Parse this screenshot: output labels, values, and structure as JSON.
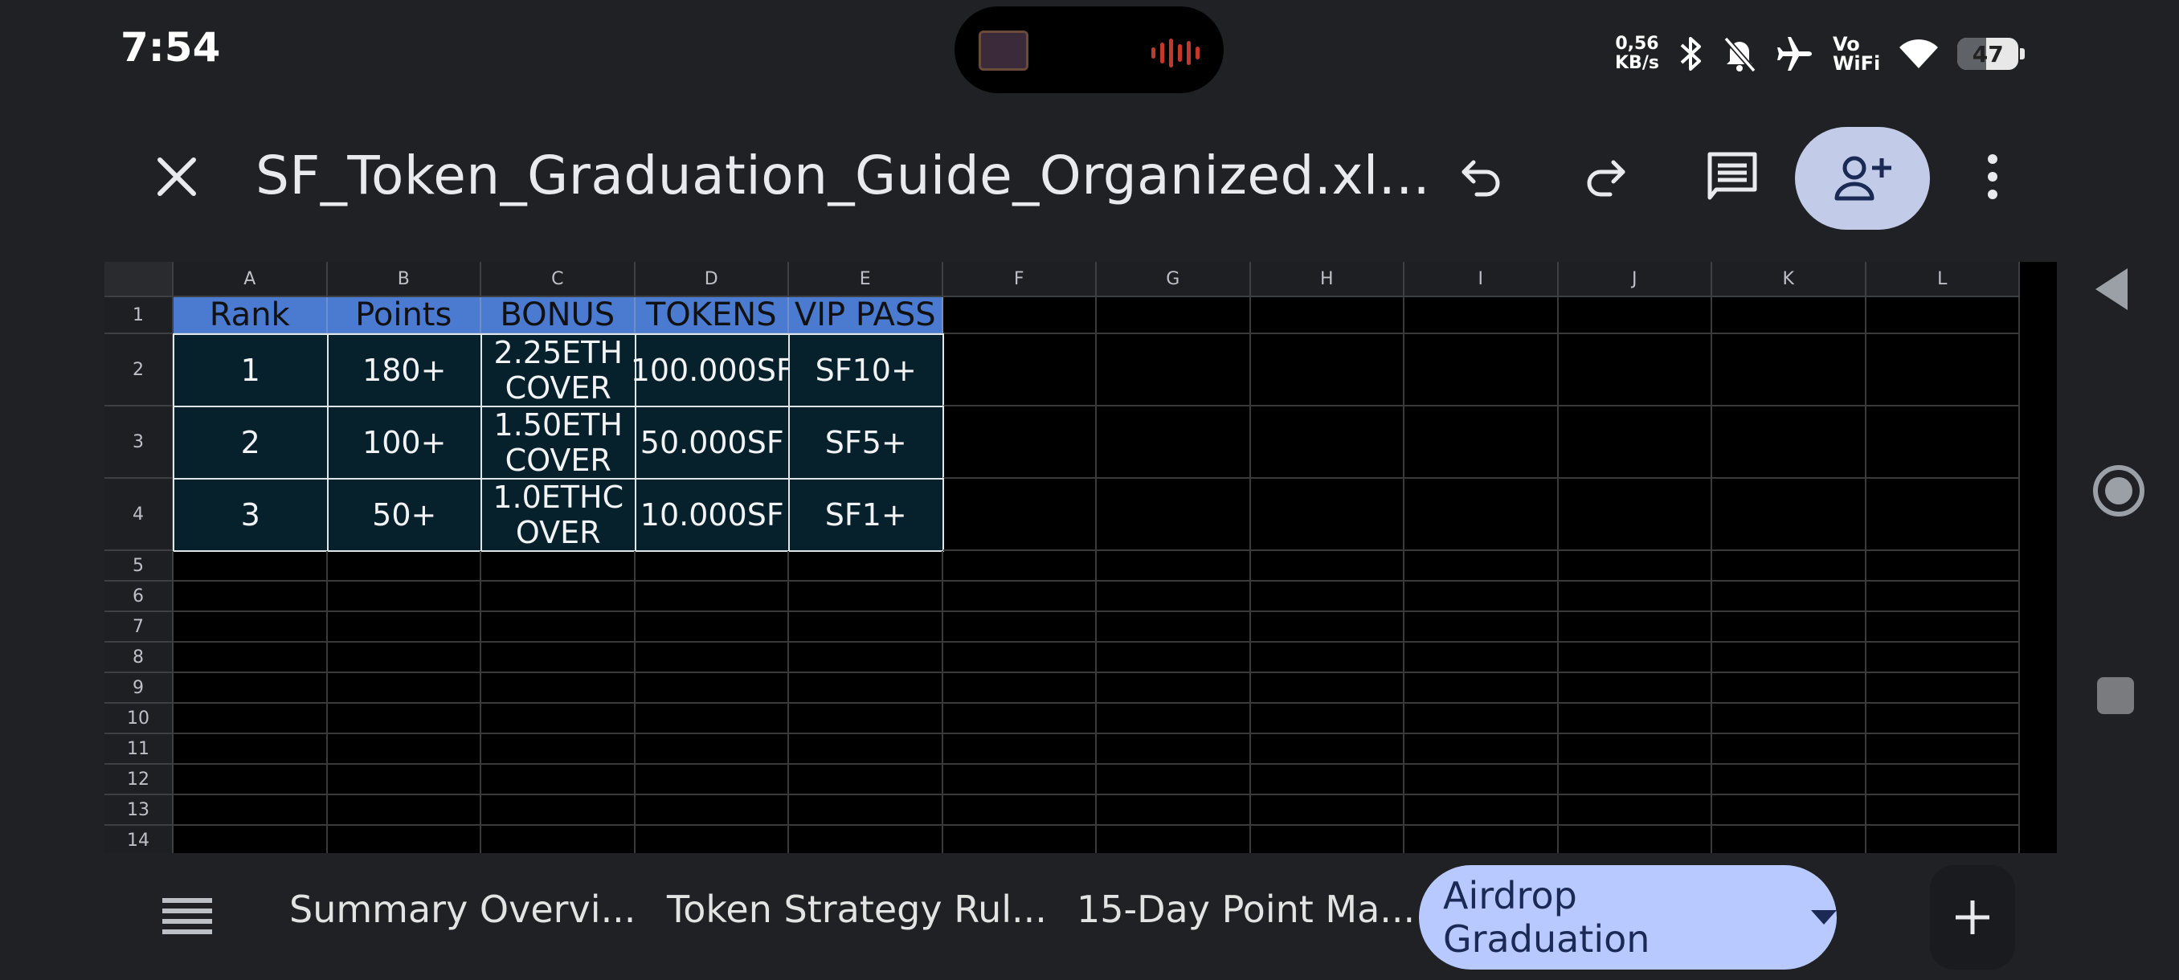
{
  "status_bar": {
    "time": "7:54",
    "net_speed_value": "0,56",
    "net_speed_unit": "KB/s",
    "vowifi_top": "Vo",
    "vowifi_bottom": "WiFi",
    "battery": "47",
    "battery_level_percent": 47
  },
  "toolbar": {
    "title": "SF_Token_Graduation_Guide_Organized.xl..."
  },
  "grid": {
    "columns": [
      "A",
      "B",
      "C",
      "D",
      "E",
      "F",
      "G",
      "H",
      "I",
      "J",
      "K",
      "L"
    ],
    "rows": [
      "1",
      "2",
      "3",
      "4",
      "5",
      "6",
      "7",
      "8",
      "9",
      "10",
      "11",
      "12",
      "13",
      "14"
    ],
    "header": [
      "Rank",
      "Points",
      "BONUS",
      "TOKENS",
      "VIP PASS"
    ],
    "data": [
      [
        "1",
        "180+",
        "2.25ETH COVER",
        "100.000SF",
        "SF10+"
      ],
      [
        "2",
        "100+",
        "1.50ETH COVER",
        "50.000SF",
        "SF5+"
      ],
      [
        "3",
        "50+",
        "1.0ETHC OVER",
        "10.000SF",
        "SF1+"
      ]
    ]
  },
  "tabs": {
    "items": [
      "Summary Overvi...",
      "Token Strategy Rul...",
      "15-Day Point Ma..."
    ],
    "active": "Airdrop Graduation"
  },
  "colors": {
    "header_fill": "#4a7bd0",
    "data_fill": "#07212c",
    "active_tab": "#b7c9ff",
    "share_button": "#c2cbe8"
  }
}
